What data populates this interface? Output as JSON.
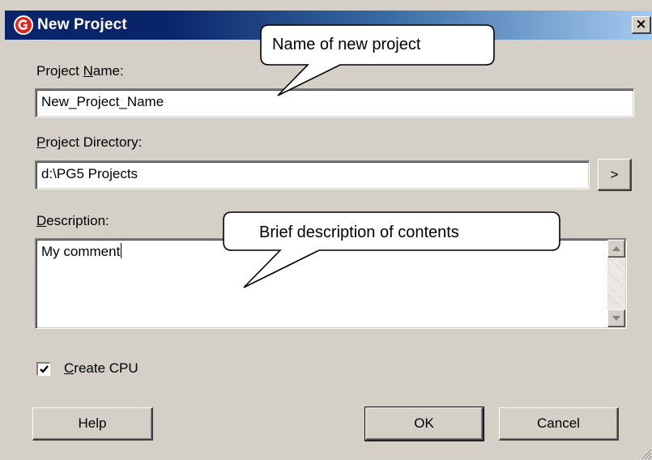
{
  "window": {
    "title": "New Project",
    "close_label": "×"
  },
  "project_name": {
    "label_pre": "Project ",
    "label_key": "N",
    "label_post": "ame:",
    "value": "New_Project_Name"
  },
  "project_directory": {
    "label_key": "P",
    "label_post": "roject Directory:",
    "value": "d:\\PG5 Projects",
    "browse_label": ">"
  },
  "description": {
    "label_key": "D",
    "label_post": "escription:",
    "value": "My comment"
  },
  "create_cpu": {
    "label_key": "C",
    "label_post": "reate CPU",
    "checked": true
  },
  "buttons": {
    "help": "Help",
    "ok": "OK",
    "cancel": "Cancel"
  },
  "callouts": {
    "name": "Name of new project",
    "description": "Brief description of contents"
  },
  "colors": {
    "dialog_bg": "#d4d0c8",
    "title_start": "#0a246a",
    "title_end": "#a6caf0",
    "app_icon": "#e8221b"
  },
  "icons": {
    "app": "app-logo-icon",
    "close": "close-icon",
    "scroll_up": "arrow-up-icon",
    "scroll_down": "arrow-down-icon",
    "check": "check-icon",
    "resize": "resize-grip-icon"
  }
}
